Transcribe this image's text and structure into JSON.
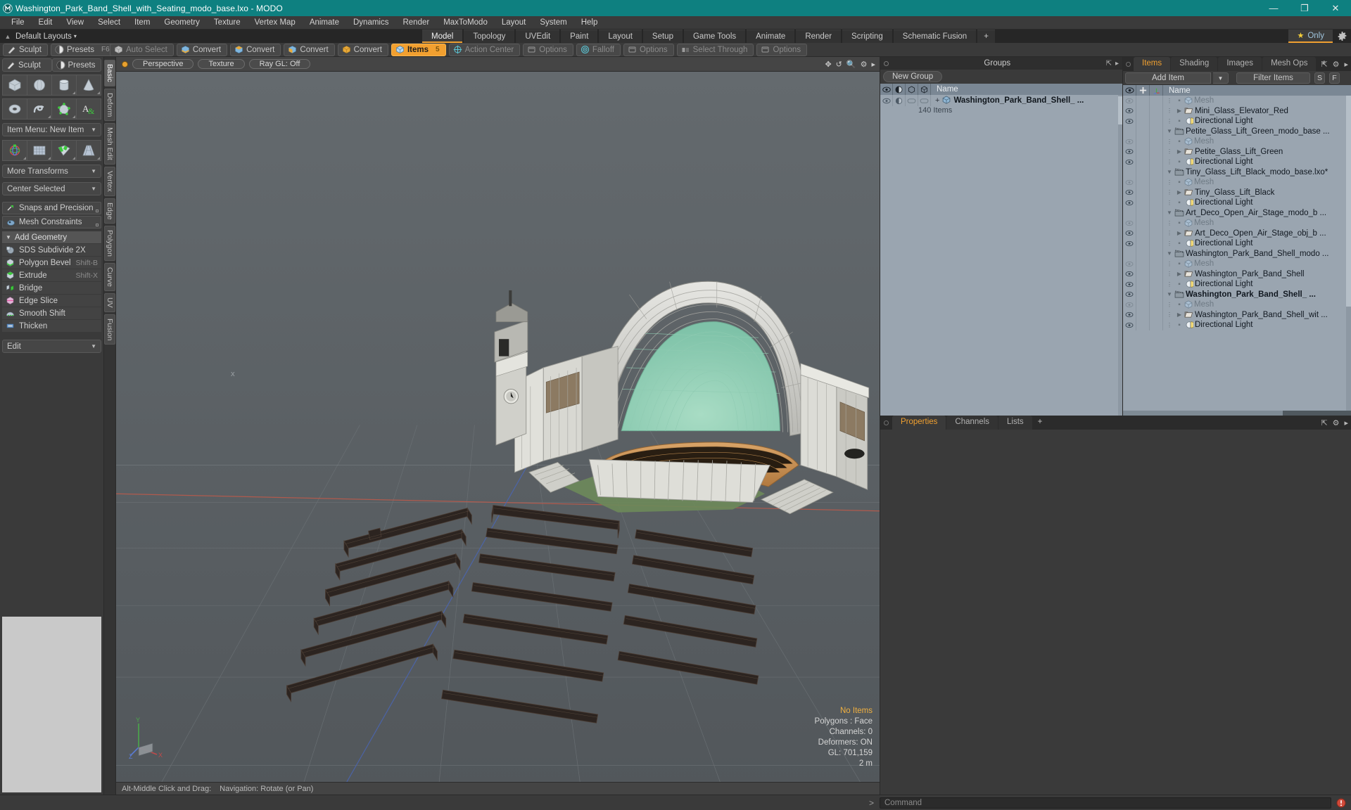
{
  "titlebar": {
    "title": "Washington_Park_Band_Shell_with_Seating_modo_base.lxo - MODO",
    "minimize": "—",
    "maximize": "❐",
    "close": "✕"
  },
  "menubar": {
    "items": [
      "File",
      "Edit",
      "View",
      "Select",
      "Item",
      "Geometry",
      "Texture",
      "Vertex Map",
      "Animate",
      "Dynamics",
      "Render",
      "MaxToModo",
      "Layout",
      "System",
      "Help"
    ]
  },
  "layoutbar": {
    "layout_label": "Default Layouts",
    "caret": "▾",
    "mode_tabs": [
      "Model",
      "Topology",
      "UVEdit",
      "Paint",
      "Layout",
      "Setup",
      "Game Tools",
      "Animate",
      "Render",
      "Scripting",
      "Schematic Fusion"
    ],
    "active_mode": "Model",
    "plus": "+",
    "only_label": "Only",
    "star": "★"
  },
  "toolbar": {
    "sculpt": "Sculpt",
    "presets": "Presets",
    "presets_key": "F6",
    "auto_select": "Auto Select",
    "convert1": "Convert",
    "convert2": "Convert",
    "convert3": "Convert",
    "convert4": "Convert",
    "items": "Items",
    "items_key": "5",
    "action_center": "Action Center",
    "options1": "Options",
    "falloff": "Falloff",
    "options2": "Options",
    "select_through": "Select Through",
    "options3": "Options"
  },
  "leftpanel": {
    "tab_sculpt": "Sculpt",
    "tab_presets": "Presets",
    "tab_presets_key": "F6",
    "prim_row1": [
      "cube-icon",
      "sphere-icon",
      "cylinder-icon",
      "cone-icon"
    ],
    "prim_row2": [
      "torus-icon",
      "spiral-icon",
      "polygon-icon",
      "text-icon"
    ],
    "item_menu": "Item Menu: New Item",
    "xform_row": [
      "transform-icon",
      "grid-icon",
      "checker-icon",
      "taper-icon"
    ],
    "more_transforms": "More Transforms",
    "center_selected": "Center Selected",
    "snaps": "Snaps and Precision",
    "mesh_constraints": "Mesh Constraints",
    "add_geometry": "Add Geometry",
    "geo_items": [
      {
        "label": "SDS Subdivide 2X",
        "shortcut": "",
        "icon": "sds-icon"
      },
      {
        "label": "Polygon Bevel",
        "shortcut": "Shift-B",
        "icon": "bevel-icon"
      },
      {
        "label": "Extrude",
        "shortcut": "Shift-X",
        "icon": "extrude-icon"
      },
      {
        "label": "Bridge",
        "shortcut": "",
        "icon": "bridge-icon"
      },
      {
        "label": "Edge Slice",
        "shortcut": "",
        "icon": "slice-icon"
      },
      {
        "label": "Smooth Shift",
        "shortcut": "",
        "icon": "smooth-icon"
      },
      {
        "label": "Thicken",
        "shortcut": "",
        "icon": "thicken-icon"
      }
    ],
    "edit_combo": "Edit",
    "vertical_tabs": [
      "Basic",
      "Deform",
      "Mesh Edit",
      "Vertex",
      "Edge",
      "Polygon",
      "Curve",
      "UV",
      "Fusion"
    ],
    "vertical_active": "Basic"
  },
  "viewport": {
    "view_mode": "Perspective",
    "shading": "Texture",
    "raygl": "Ray GL: Off",
    "status": {
      "selection": "No Items",
      "polygons": "Polygons : Face",
      "channels": "Channels: 0",
      "deformers": "Deformers: ON",
      "gl": "GL: 701,159",
      "scale": "2 m"
    },
    "axis": {
      "x": "X",
      "y": "Y",
      "z": "Z"
    }
  },
  "statusbar": {
    "hint_key": "Alt-Middle Click and Drag:",
    "hint_text": "Navigation: Rotate (or Pan)"
  },
  "groups": {
    "title": "Groups",
    "new_group": "New Group",
    "col_name": "Name",
    "rows": [
      {
        "name": "Washington_Park_Band_Shell_ ...",
        "sub": "140 Items",
        "bold": true
      }
    ]
  },
  "items": {
    "tabs": [
      "Items",
      "Shading",
      "Images",
      "Mesh Ops"
    ],
    "active_tab": "Items",
    "plus": "+",
    "add_item": "Add Item",
    "filter_items": "Filter Items",
    "btn_s": "S",
    "btn_f": "F",
    "col_name": "Name",
    "rows": [
      {
        "label": "Mesh",
        "type": "mesh",
        "depth": 2,
        "dim": true,
        "marker": "dot",
        "eye": true
      },
      {
        "label": "Mini_Glass_Elevator_Red",
        "type": "group",
        "depth": 2,
        "dim": false,
        "marker": "right",
        "eye": true
      },
      {
        "label": "Directional Light",
        "type": "light",
        "depth": 2,
        "dim": false,
        "marker": "dot",
        "eye": true
      },
      {
        "label": "Petite_Glass_Lift_Green_modo_base ...",
        "type": "scene",
        "depth": 1,
        "dim": false,
        "marker": "down",
        "eye": false
      },
      {
        "label": "Mesh",
        "type": "mesh",
        "depth": 2,
        "dim": true,
        "marker": "dot",
        "eye": true
      },
      {
        "label": "Petite_Glass_Lift_Green",
        "type": "group",
        "depth": 2,
        "dim": false,
        "marker": "right",
        "eye": true
      },
      {
        "label": "Directional Light",
        "type": "light",
        "depth": 2,
        "dim": false,
        "marker": "dot",
        "eye": true
      },
      {
        "label": "Tiny_Glass_Lift_Black_modo_base.lxo*",
        "type": "scene",
        "depth": 1,
        "dim": false,
        "marker": "down",
        "eye": false
      },
      {
        "label": "Mesh",
        "type": "mesh",
        "depth": 2,
        "dim": true,
        "marker": "dot",
        "eye": true
      },
      {
        "label": "Tiny_Glass_Lift_Black",
        "type": "group",
        "depth": 2,
        "dim": false,
        "marker": "right",
        "eye": true
      },
      {
        "label": "Directional Light",
        "type": "light",
        "depth": 2,
        "dim": false,
        "marker": "dot",
        "eye": true
      },
      {
        "label": "Art_Deco_Open_Air_Stage_modo_b ...",
        "type": "scene",
        "depth": 1,
        "dim": false,
        "marker": "down",
        "eye": false
      },
      {
        "label": "Mesh",
        "type": "mesh",
        "depth": 2,
        "dim": true,
        "marker": "dot",
        "eye": true
      },
      {
        "label": "Art_Deco_Open_Air_Stage_obj_b ...",
        "type": "group",
        "depth": 2,
        "dim": false,
        "marker": "right",
        "eye": true
      },
      {
        "label": "Directional Light",
        "type": "light",
        "depth": 2,
        "dim": false,
        "marker": "dot",
        "eye": true
      },
      {
        "label": "Washington_Park_Band_Shell_modo ...",
        "type": "scene",
        "depth": 1,
        "dim": false,
        "marker": "down",
        "eye": false
      },
      {
        "label": "Mesh",
        "type": "mesh",
        "depth": 2,
        "dim": true,
        "marker": "dot",
        "eye": true
      },
      {
        "label": "Washington_Park_Band_Shell",
        "type": "group",
        "depth": 2,
        "dim": false,
        "marker": "right",
        "eye": true
      },
      {
        "label": "Directional Light",
        "type": "light",
        "depth": 2,
        "dim": false,
        "marker": "dot",
        "eye": true
      },
      {
        "label": "Washington_Park_Band_Shell_ ...",
        "type": "scene",
        "depth": 1,
        "dim": false,
        "marker": "down",
        "eye": true,
        "bold": true
      },
      {
        "label": "Mesh",
        "type": "mesh",
        "depth": 2,
        "dim": true,
        "marker": "dot",
        "eye": true
      },
      {
        "label": "Washington_Park_Band_Shell_wit ...",
        "type": "group",
        "depth": 2,
        "dim": false,
        "marker": "right",
        "eye": true
      },
      {
        "label": "Directional Light",
        "type": "light",
        "depth": 2,
        "dim": false,
        "marker": "dot",
        "eye": true
      }
    ]
  },
  "properties": {
    "tabs": [
      "Properties",
      "Channels",
      "Lists"
    ],
    "active_tab": "Properties",
    "plus": "+"
  },
  "command": {
    "placeholder": "Command",
    "prompt": ">"
  },
  "colors": {
    "title_bg": "#0e8080",
    "accent": "#f0a030",
    "panel_bg": "#3a3a3a",
    "tree_bg": "#9aa5b0",
    "tree_header": "#7a8794",
    "viewport_bg": "#5d6266"
  }
}
